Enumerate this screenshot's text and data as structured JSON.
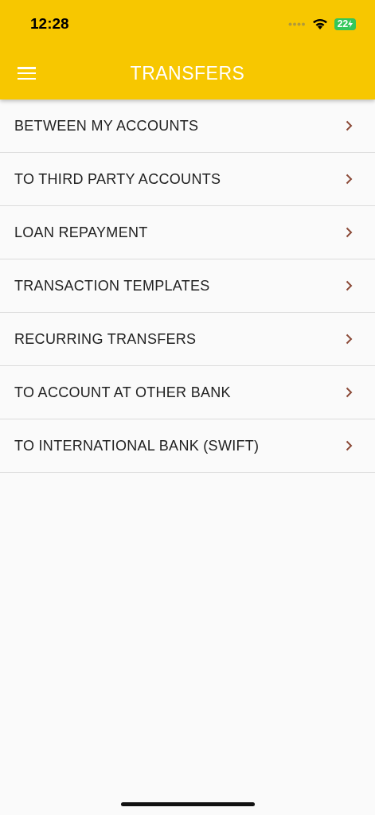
{
  "status_bar": {
    "time": "12:28",
    "battery": "22"
  },
  "header": {
    "title": "TRANSFERS"
  },
  "menu_items": [
    {
      "label": "BETWEEN MY ACCOUNTS"
    },
    {
      "label": "TO THIRD PARTY ACCOUNTS"
    },
    {
      "label": "LOAN REPAYMENT"
    },
    {
      "label": "TRANSACTION TEMPLATES"
    },
    {
      "label": "RECURRING TRANSFERS"
    },
    {
      "label": "TO ACCOUNT AT OTHER BANK"
    },
    {
      "label": "TO INTERNATIONAL BANK (SWIFT)"
    }
  ]
}
